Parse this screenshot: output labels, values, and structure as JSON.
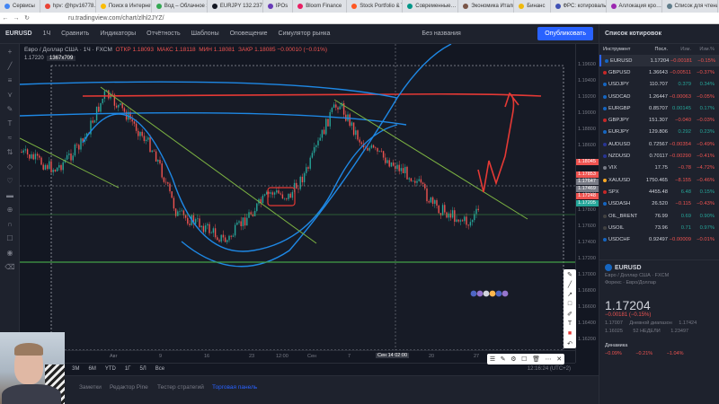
{
  "browser": {
    "tabs": [
      {
        "label": "Сервисы",
        "color": "#4285f4"
      },
      {
        "label": "hpv: @hpv16778…",
        "color": "#ea4335"
      },
      {
        "label": "Поиск в Интернете",
        "color": "#fbbc05"
      },
      {
        "label": "Вод – Облачное хр…",
        "color": "#34a853"
      },
      {
        "label": "EURJPY 132.237…",
        "color": "#131722"
      },
      {
        "label": "IPOs",
        "color": "#673ab7"
      },
      {
        "label": "Bloom Finance",
        "color": "#e91e63"
      },
      {
        "label": "Stock Portfolio & Tr…",
        "color": "#ff5722"
      },
      {
        "label": "Современные…",
        "color": "#009688"
      },
      {
        "label": "Экономика Итали…",
        "color": "#795548"
      },
      {
        "label": "Бинанс",
        "color": "#f0b90b"
      },
      {
        "label": "ФРС: котировальны…",
        "color": "#3f51b5"
      },
      {
        "label": "Аллокация кро…",
        "color": "#9c27b0"
      },
      {
        "label": "Список для чтения",
        "color": "#607d8b"
      }
    ],
    "url": "ru.tradingview.com/chart/zlhl2JYZ/"
  },
  "toolbar": {
    "symbol": "EURUSD",
    "interval": "1Ч",
    "compare": "Сравнить",
    "indicators": "Индикаторы",
    "reports": "Отчётность",
    "templates": "Шаблоны",
    "alert": "Оповещение",
    "replay": "Симулятор рынка",
    "name": "Без названия",
    "publish": "Опубликовать"
  },
  "legend": {
    "title": "Евро / Доллар США · 1Ч · FXCM",
    "open": "ОТКР 1.18093",
    "high": "МАКС 1.18118",
    "low": "МИН 1.18081",
    "close": "ЗАКР 1.18085 −0.00010 (−0.01%)",
    "sub": "1.17220",
    "size": "1367x709"
  },
  "price_scale": {
    "ticks": [
      "1.19600",
      "1.19400",
      "1.19200",
      "1.19000",
      "1.18800",
      "1.18600",
      "1.18400",
      "1.18200",
      "1.18000",
      "1.17800",
      "1.17600",
      "1.17400",
      "1.17200",
      "1.17000",
      "1.16800",
      "1.16600",
      "1.16400",
      "1.16200"
    ],
    "badges": [
      {
        "label": "1.18045",
        "color": "#ef5350"
      },
      {
        "label": "1.17853",
        "color": "#ef5350"
      },
      {
        "label": "1.17647",
        "color": "#787b86"
      },
      {
        "label": "1.17469",
        "color": "#787b86"
      },
      {
        "label": "1.17248",
        "color": "#ef5350"
      },
      {
        "label": "1.17205",
        "color": "#26a69a"
      }
    ]
  },
  "time_scale": {
    "ticks": [
      "26",
      "Авг",
      "9",
      "16",
      "23",
      "Сен",
      "7",
      "14",
      "20",
      "27"
    ],
    "cursor": "Сен 14 02:00",
    "time": "12:00"
  },
  "ranges": [
    "1Д",
    "5Д",
    "1М",
    "3М",
    "6М",
    "YTD",
    "1Г",
    "5Л",
    "Все"
  ],
  "status": "12:16:24 (UTC+2)",
  "bottom_tabs": [
    "Заметки",
    "Редактор Pine",
    "Тестер стратегий",
    "Торговая панель"
  ],
  "watchlist": {
    "title": "Список котировок",
    "headers": [
      "Инструмент",
      "Посл.",
      "Изм.",
      "Изм.%"
    ],
    "rows": [
      {
        "symbol": "EURUSD",
        "last": "1.17204",
        "chg": "−0.00181",
        "pct": "−0.15%",
        "dir": "neg",
        "flag": "#1565c0"
      },
      {
        "symbol": "GBPUSD",
        "last": "1.36643",
        "chg": "−0.00511",
        "pct": "−0.37%",
        "dir": "neg",
        "flag": "#c62828"
      },
      {
        "symbol": "USDJPY",
        "last": "110.707",
        "chg": "0.379",
        "pct": "0.34%",
        "dir": "pos",
        "flag": "#1565c0"
      },
      {
        "symbol": "USDCAD",
        "last": "1.26447",
        "chg": "−0.00063",
        "pct": "−0.05%",
        "dir": "neg",
        "flag": "#1565c0"
      },
      {
        "symbol": "EURGBP",
        "last": "0.85707",
        "chg": "0.00145",
        "pct": "0.17%",
        "dir": "pos",
        "flag": "#1565c0"
      },
      {
        "symbol": "GBPJPY",
        "last": "151.307",
        "chg": "−0.040",
        "pct": "−0.03%",
        "dir": "neg",
        "flag": "#c62828"
      },
      {
        "symbol": "EURJPY",
        "last": "129.806",
        "chg": "0.292",
        "pct": "0.23%",
        "dir": "pos",
        "flag": "#1565c0"
      },
      {
        "symbol": "AUDUSD",
        "last": "0.72567",
        "chg": "−0.00354",
        "pct": "−0.49%",
        "dir": "neg",
        "flag": "#283593"
      },
      {
        "symbol": "NZDUSD",
        "last": "0.70117",
        "chg": "−0.00290",
        "pct": "−0.41%",
        "dir": "neg",
        "flag": "#283593"
      },
      {
        "symbol": "VIX",
        "last": "17.75",
        "chg": "−0.78",
        "pct": "−4.72%",
        "dir": "neg",
        "flag": "#787b86"
      },
      {
        "symbol": "XAUUSD",
        "last": "1750.465",
        "chg": "−8.155",
        "pct": "−0.46%",
        "dir": "neg",
        "flag": "#f9a825"
      },
      {
        "symbol": "SPX",
        "last": "4455.48",
        "chg": "6.48",
        "pct": "0.15%",
        "dir": "pos",
        "flag": "#c62828"
      },
      {
        "symbol": "USDASH",
        "last": "26.520",
        "chg": "−0.115",
        "pct": "−0.43%",
        "dir": "neg",
        "flag": "#1565c0"
      },
      {
        "symbol": "OIL_BRENT",
        "last": "76.99",
        "chg": "0.69",
        "pct": "0.90%",
        "dir": "pos",
        "flag": "#424242"
      },
      {
        "symbol": "USOIL",
        "last": "73.96",
        "chg": "0.71",
        "pct": "0.97%",
        "dir": "pos",
        "flag": "#424242"
      },
      {
        "symbol": "USDCHF",
        "last": "0.92497",
        "chg": "−0.00009",
        "pct": "−0.01%",
        "dir": "neg",
        "flag": "#1565c0"
      }
    ]
  },
  "details": {
    "symbol": "EURUSD",
    "name": "Евро / Доллар США · FXCM",
    "sub": "Форекс · Евро/Доллар",
    "price": "1.17204",
    "change": "−0.00181 (−0.15%)",
    "range_low": "1.17007",
    "range_high": "1.17424",
    "range_label": "Дневной диапазон",
    "week_low": "1.16025",
    "week_high": "1.23497",
    "week_label": "52 НЕДЕЛИ",
    "dynamics": "Динамика",
    "dyn_values": [
      "−0.09%",
      "−0.21%",
      "−1.04%"
    ]
  }
}
